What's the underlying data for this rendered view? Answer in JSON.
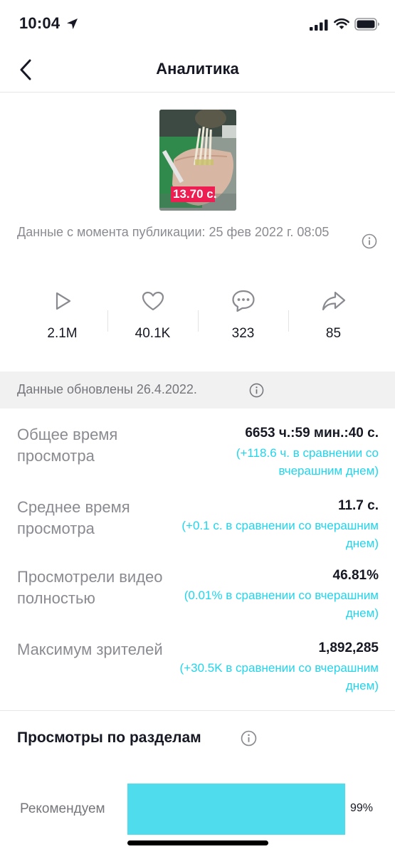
{
  "status_bar": {
    "time": "10:04"
  },
  "header": {
    "title": "Аналитика"
  },
  "video": {
    "thumbnail_caption": "13.70 с.",
    "published_text": "Данные с момента публикации: 25 фев 2022 г. 08:05"
  },
  "stats": [
    {
      "icon": "play-icon",
      "value": "2.1M"
    },
    {
      "icon": "heart-icon",
      "value": "40.1K"
    },
    {
      "icon": "comment-icon",
      "value": "323"
    },
    {
      "icon": "share-icon",
      "value": "85"
    }
  ],
  "updated": {
    "text": "Данные обновлены 26.4.2022."
  },
  "metrics": [
    {
      "label": "Общее время просмотра",
      "value": "6653 ч.:59 мин.:40 с.",
      "comparison": "(+118.6 ч. в сравнении со вчерашним днем)"
    },
    {
      "label": "Среднее время просмотра",
      "value": "11.7 с.",
      "comparison": "(+0.1 с. в сравнении со вчерашним днем)"
    },
    {
      "label": "Просмотрели видео полностью",
      "value": "46.81%",
      "comparison": "(0.01% в сравнении со вчерашним днем)"
    },
    {
      "label": "Максимум зрителей",
      "value": "1,892,285",
      "comparison": "(+30.5K в сравнении со вчерашним днем)"
    }
  ],
  "traffic": {
    "title": "Просмотры по разделам",
    "items": [
      {
        "label": "Рекомендуем",
        "percent": "99%",
        "fraction": 0.99
      }
    ]
  },
  "colors": {
    "accent": "#20d5ec",
    "bar": "#4fdded",
    "text": "#161823",
    "muted": "#8a8b91",
    "band": "#f1f1f2"
  }
}
